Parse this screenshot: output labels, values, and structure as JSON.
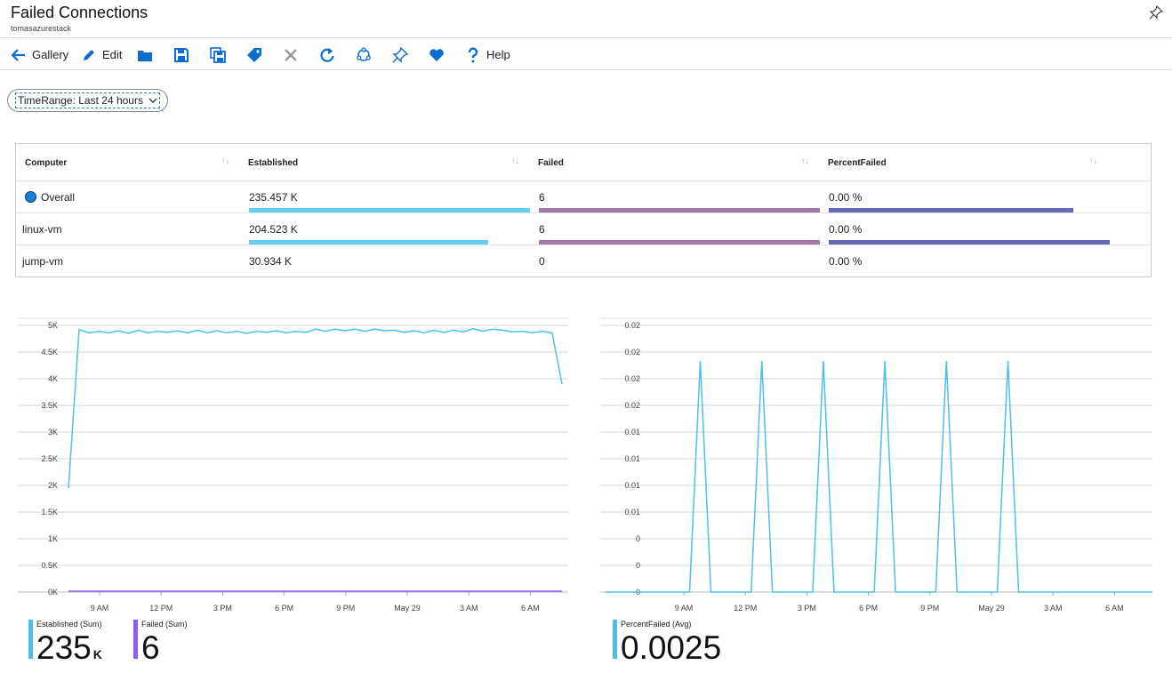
{
  "header": {
    "title": "Failed Connections",
    "subtitle": "tomasazurestack"
  },
  "toolbar": {
    "gallery_label": "Gallery",
    "edit_label": "Edit",
    "help_label": "Help"
  },
  "timerange": {
    "label": "TimeRange: Last 24 hours"
  },
  "grid": {
    "columns": [
      "Computer",
      "Established",
      "Failed",
      "PercentFailed"
    ],
    "rows": [
      {
        "computer": "Overall",
        "established": "235.457 K",
        "failed": "6",
        "percent": "0.00 %",
        "established_bar": 1.0,
        "failed_bar": 1.0,
        "percent_bar": 0.87
      },
      {
        "computer": "linux-vm",
        "established": "204.523 K",
        "failed": "6",
        "percent": "0.00 %",
        "established_bar": 0.85,
        "failed_bar": 1.0,
        "percent_bar": 1.0
      },
      {
        "computer": "jump-vm",
        "established": "30.934 K",
        "failed": "0",
        "percent": "0.00 %",
        "established_bar": 0,
        "failed_bar": 0,
        "percent_bar": 0
      }
    ],
    "colors": {
      "established": "#5fcff2",
      "failed": "#a479a8",
      "percent": "#6468b5",
      "dot": "#1a7fd4"
    }
  },
  "chart_data": [
    {
      "type": "line",
      "x_ticks": [
        "9 AM",
        "12 PM",
        "3 PM",
        "6 PM",
        "9 PM",
        "May 29",
        "3 AM",
        "6 AM"
      ],
      "y_ticks": [
        "0K",
        "0.5K",
        "1K",
        "1.5K",
        "2K",
        "2.5K",
        "3K",
        "3.5K",
        "4K",
        "4.5K",
        "5K"
      ],
      "ylim": [
        0,
        5000
      ],
      "series": [
        {
          "name": "Established (Sum)",
          "color": "#4cc0ea",
          "values": [
            1950,
            4920,
            4860,
            4890,
            4860,
            4900,
            4850,
            4910,
            4860,
            4890,
            4870,
            4900,
            4860,
            4910,
            4860,
            4900,
            4860,
            4890,
            4850,
            4890,
            4870,
            4900,
            4860,
            4890,
            4870,
            4930,
            4890,
            4930,
            4900,
            4930,
            4890,
            4930,
            4900,
            4910,
            4870,
            4900,
            4860,
            4910,
            4870,
            4910,
            4880,
            4940,
            4890,
            4930,
            4910,
            4880,
            4890,
            4860,
            4890,
            4860,
            3900
          ]
        },
        {
          "name": "Failed (Sum)",
          "color": "#8a5cf5",
          "values": [
            0,
            0
          ]
        }
      ]
    },
    {
      "type": "line",
      "x_ticks": [
        "9 AM",
        "12 PM",
        "3 PM",
        "6 PM",
        "9 PM",
        "May 29",
        "3 AM",
        "6 AM"
      ],
      "y_ticks": [
        "0",
        "0",
        "0",
        "0.01",
        "0.01",
        "0.01",
        "0.01",
        "0.02",
        "0.02",
        "0.02",
        "0.02"
      ],
      "series": [
        {
          "name": "PercentFailed (Avg)",
          "color": "#4cc0ea",
          "spike_hours": [
            1.8,
            4.8,
            7.8,
            10.8,
            13.8,
            16.8
          ],
          "spike_value": 0.0195
        }
      ]
    }
  ],
  "legends": {
    "established": {
      "label": "Established (Sum)",
      "value": "235",
      "unit": "K",
      "color": "#4cc0ea"
    },
    "failed": {
      "label": "Failed (Sum)",
      "value": "6",
      "color": "#8a5cf5"
    },
    "percent": {
      "label": "PercentFailed (Avg)",
      "value": "0.0025",
      "color": "#4cc0ea"
    }
  }
}
